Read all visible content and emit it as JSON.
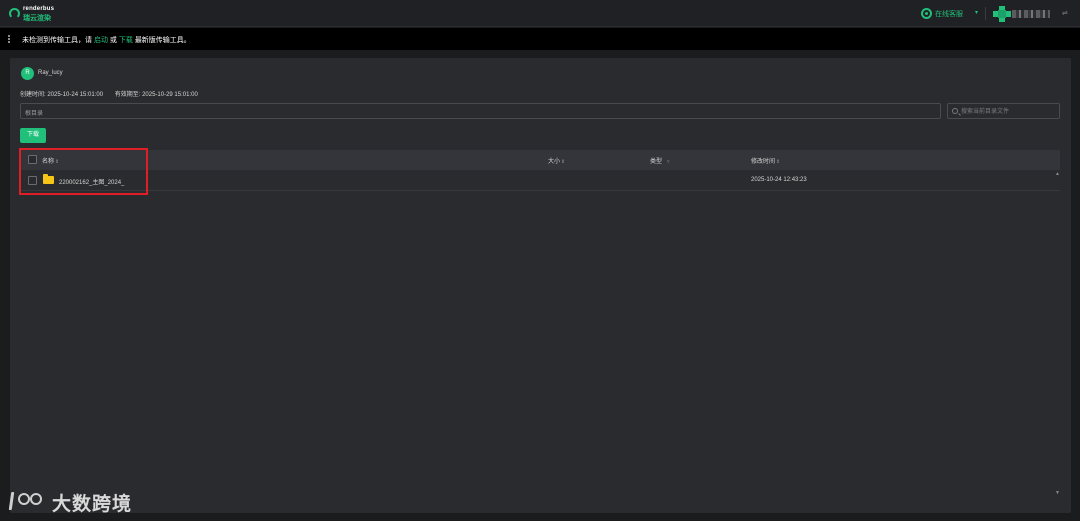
{
  "header": {
    "logo_line1": "renderbus",
    "logo_line2": "瑞云渲染",
    "support_label": "在线客服",
    "support_caret": "▾",
    "user_caret": "⇌"
  },
  "notice": {
    "text_before": "未检测到传输工具，请",
    "launch_link": "启动",
    "or_text": "或",
    "download_link": "下载",
    "text_after": "最新版传输工具。"
  },
  "share": {
    "user_initial": "R",
    "user_name": "Ray_lucy",
    "created_label": "创建时间: 2025-10-24 15:01:00",
    "expires_label": "有效期至: 2025-10-29 15:01:00",
    "path_value": "根目录",
    "search_placeholder": "搜索当前目录文件",
    "download_button": "下载"
  },
  "table": {
    "columns": {
      "name": "名称",
      "size": "大小",
      "type": "类型",
      "modified": "修改时间",
      "sort_glyph": "⇕",
      "filter_glyph": "▿"
    },
    "rows": [
      {
        "name": "220002162_主图_2024_",
        "size": "",
        "type": "",
        "modified": "2025-10-24 12:43:23"
      }
    ]
  },
  "scrollbar": {
    "up": "▲",
    "down": "▼"
  },
  "watermark": {
    "text": "大数跨境"
  },
  "colors": {
    "accent": "#20c07a",
    "highlight_box": "#e01e26",
    "folder": "#f5c518"
  }
}
